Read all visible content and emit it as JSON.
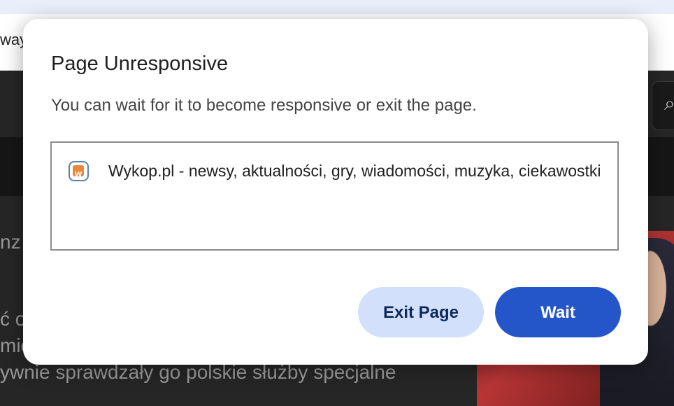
{
  "background": {
    "address_fragment": "way",
    "text_lines": [
      "nz",
      "ć o",
      "mie",
      "ywnie sprawdzały go polskie służby specjalne"
    ]
  },
  "dialog": {
    "title": "Page Unresponsive",
    "message": "You can wait for it to become responsive or exit the page.",
    "tabs": [
      {
        "title": "Wykop.pl - newsy, aktualności, gry, wiadomości, muzyka, ciekawostki",
        "icon": "wykop-favicon-icon"
      }
    ],
    "buttons": {
      "exit_label": "Exit Page",
      "wait_label": "Wait"
    }
  },
  "colors": {
    "wait_button": "#2556c9",
    "exit_button": "#d3e0fb",
    "favicon_border": "#5b83a8",
    "favicon_fill": "#e8883a"
  }
}
